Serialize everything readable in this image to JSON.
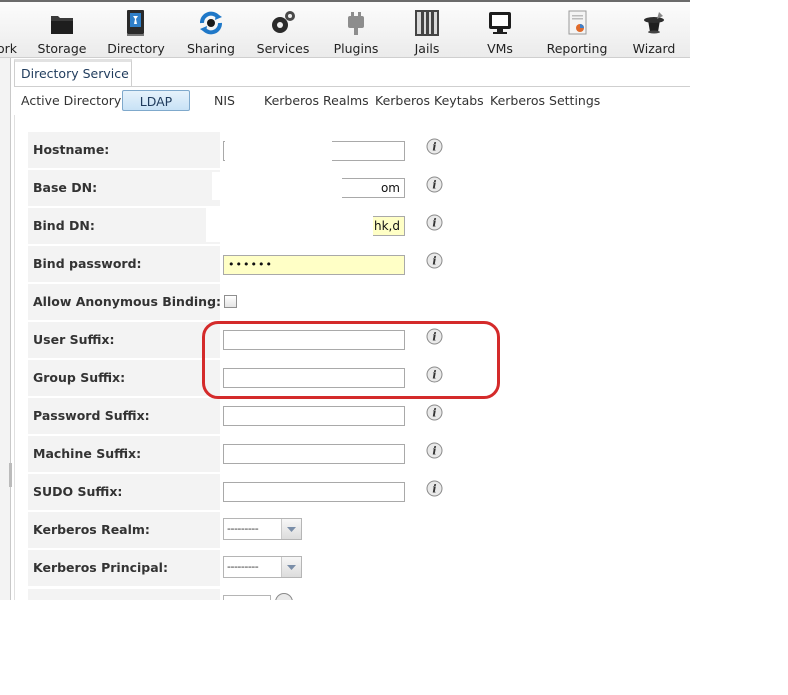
{
  "toolbar": {
    "items": [
      {
        "label": "ork",
        "icon": "network-icon"
      },
      {
        "label": "Storage",
        "icon": "storage-icon"
      },
      {
        "label": "Directory",
        "icon": "directory-icon"
      },
      {
        "label": "Sharing",
        "icon": "sharing-icon"
      },
      {
        "label": "Services",
        "icon": "services-icon"
      },
      {
        "label": "Plugins",
        "icon": "plugins-icon"
      },
      {
        "label": "Jails",
        "icon": "jails-icon"
      },
      {
        "label": "VMs",
        "icon": "vms-icon"
      },
      {
        "label": "Reporting",
        "icon": "reporting-icon"
      },
      {
        "label": "Wizard",
        "icon": "wizard-icon"
      }
    ]
  },
  "tab": {
    "label": "Directory Service"
  },
  "subtabs": {
    "active_directory": "Active Directory",
    "ldap": "LDAP",
    "nis": "NIS",
    "kerberos_realms": "Kerberos Realms",
    "kerberos_keytabs": "Kerberos Keytabs",
    "kerberos_settings": "Kerberos Settings"
  },
  "form": {
    "hostname": {
      "label": "Hostname:",
      "value": ""
    },
    "base_dn": {
      "label": "Base DN:",
      "value": "om"
    },
    "bind_dn": {
      "label": "Bind DN:",
      "value": "hk,d"
    },
    "bind_password": {
      "label": "Bind password:",
      "value": "••••••"
    },
    "anonymous_binding": {
      "label": "Allow Anonymous Binding:",
      "checked": false
    },
    "user_suffix": {
      "label": "User Suffix:",
      "value": ""
    },
    "group_suffix": {
      "label": "Group Suffix:",
      "value": ""
    },
    "password_suffix": {
      "label": "Password Suffix:",
      "value": ""
    },
    "machine_suffix": {
      "label": "Machine Suffix:",
      "value": ""
    },
    "sudo_suffix": {
      "label": "SUDO Suffix:",
      "value": ""
    },
    "kerberos_realm": {
      "label": "Kerberos Realm:",
      "value": "---------"
    },
    "kerberos_principal": {
      "label": "Kerberos Principal:",
      "value": "---------"
    }
  },
  "colors": {
    "highlight": "#d42a2a",
    "yellow_field": "#ffffc6",
    "active_tab": "#c8e2f6"
  }
}
